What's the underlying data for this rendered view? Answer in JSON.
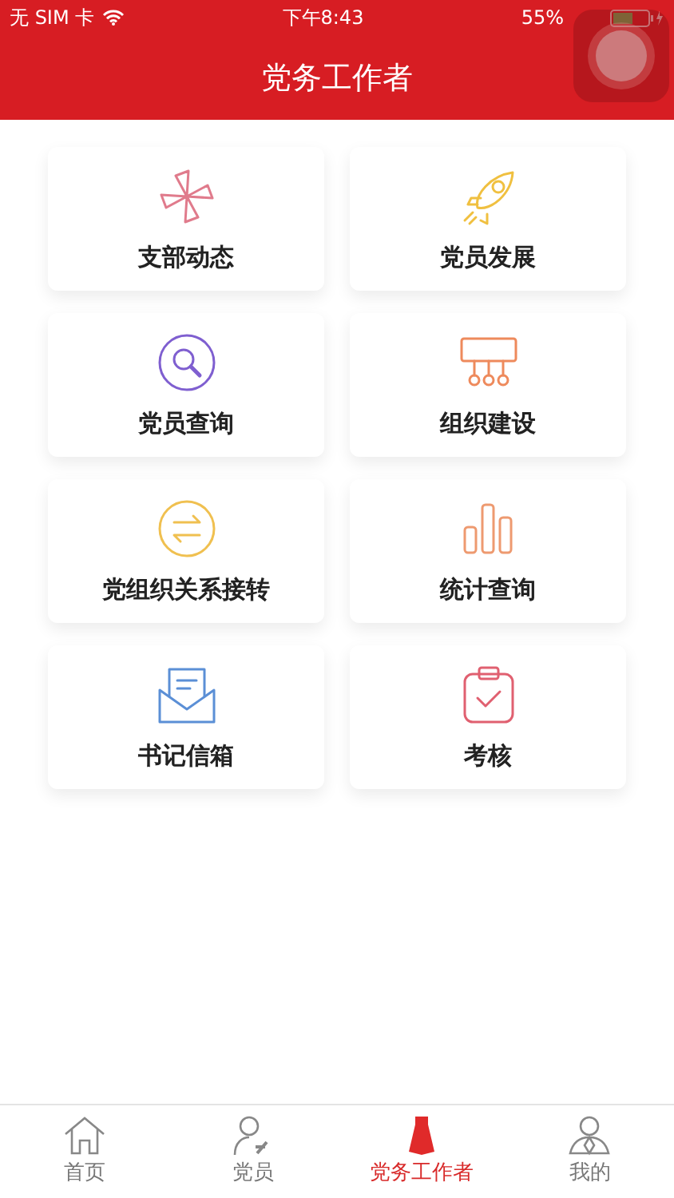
{
  "status_bar": {
    "carrier": "无 SIM 卡",
    "time": "下午8:43",
    "battery": "55%"
  },
  "header": {
    "title": "党务工作者"
  },
  "tiles": [
    {
      "label": "支部动态",
      "kind": "pinwheel",
      "color": "#e07b8c"
    },
    {
      "label": "党员发展",
      "kind": "rocket",
      "color": "#f0c040"
    },
    {
      "label": "党员查询",
      "kind": "search",
      "color": "#7f5fd0"
    },
    {
      "label": "组织建设",
      "kind": "org",
      "color": "#ee8a5c"
    },
    {
      "label": "党组织关系接转",
      "kind": "transfer",
      "color": "#f0c050"
    },
    {
      "label": "统计查询",
      "kind": "bars",
      "color": "#ee9a70"
    },
    {
      "label": "书记信箱",
      "kind": "mail",
      "color": "#5b8fd6"
    },
    {
      "label": "考核",
      "kind": "clipboard",
      "color": "#e06070"
    }
  ],
  "tab_bar": [
    {
      "label": "首页",
      "kind": "home",
      "selected": false
    },
    {
      "label": "党员",
      "kind": "member",
      "selected": false
    },
    {
      "label": "党务工作者",
      "kind": "worker",
      "selected": true
    },
    {
      "label": "我的",
      "kind": "profile",
      "selected": false
    }
  ]
}
